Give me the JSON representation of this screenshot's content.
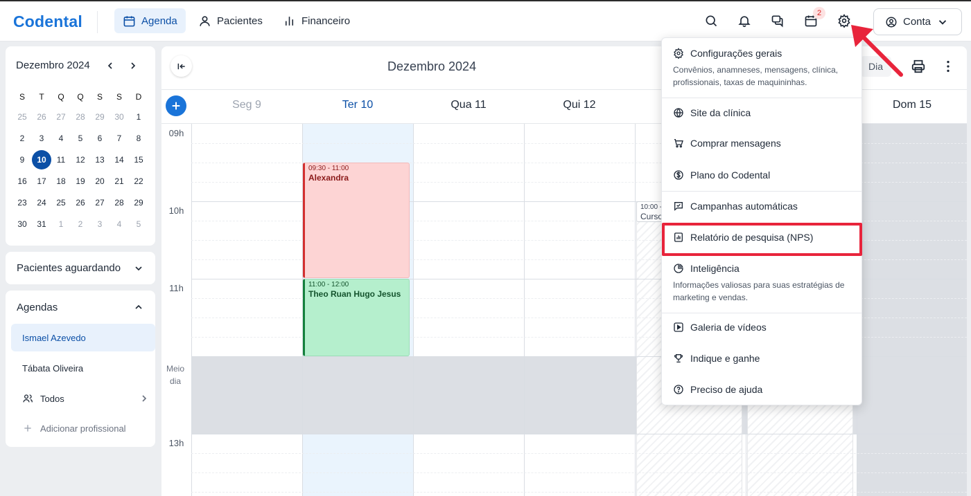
{
  "app": {
    "logo": "Codental",
    "nav": [
      {
        "label": "Agenda",
        "icon": "calendar-icon",
        "active": true
      },
      {
        "label": "Pacientes",
        "icon": "user-icon",
        "active": false
      },
      {
        "label": "Financeiro",
        "icon": "bar-chart-icon",
        "active": false
      }
    ],
    "top_icons": [
      "search-icon",
      "bell-icon",
      "chat-icon",
      "calendar-icon",
      "gear-icon"
    ],
    "notification_count": "2",
    "account_label": "Conta"
  },
  "sidebar": {
    "mini_calendar": {
      "title": "Dezembro 2024",
      "weekdays": [
        "S",
        "T",
        "Q",
        "Q",
        "S",
        "S",
        "D"
      ],
      "weeks": [
        [
          "25",
          "26",
          "27",
          "28",
          "29",
          "30",
          "1"
        ],
        [
          "2",
          "3",
          "4",
          "5",
          "6",
          "7",
          "8"
        ],
        [
          "9",
          "10",
          "11",
          "12",
          "13",
          "14",
          "15"
        ],
        [
          "16",
          "17",
          "18",
          "19",
          "20",
          "21",
          "22"
        ],
        [
          "23",
          "24",
          "25",
          "26",
          "27",
          "28",
          "29"
        ],
        [
          "30",
          "31",
          "1",
          "2",
          "3",
          "4",
          "5"
        ]
      ],
      "selected_day": "10"
    },
    "waiting_patients_label": "Pacientes aguardando",
    "agendas_title": "Agendas",
    "agendas": [
      "Ismael Azevedo",
      "Tábata Oliveira"
    ],
    "all_label": "Todos",
    "add_professional_label": "Adicionar profissional"
  },
  "calendar": {
    "title": "Dezembro 2024",
    "view_label": "Dia",
    "days": [
      {
        "label": "Seg 9"
      },
      {
        "label": "Ter 10"
      },
      {
        "label": "Qua 11"
      },
      {
        "label": "Qui 12"
      },
      {
        "label": ""
      },
      {
        "label": ""
      },
      {
        "label": "Dom 15"
      }
    ],
    "hours": [
      "09h",
      "10h",
      "11h",
      "Meio dia",
      "13h"
    ],
    "events": [
      {
        "time": "09:30 - 11:00",
        "name": "Alexandra",
        "color": "#fdd4d4"
      },
      {
        "time": "11:00 - 12:00",
        "name": "Theo Ruan Hugo Jesus",
        "color": "#b5efcd"
      },
      {
        "time": "10:00 -",
        "name": "Curso"
      }
    ]
  },
  "settings_menu": {
    "items": [
      {
        "label": "Configurações gerais",
        "icon": "gear-icon",
        "description": "Convênios, anamneses, mensagens, clínica, profissionais, taxas de maquininhas."
      },
      {
        "label": "Site da clínica",
        "icon": "globe-icon"
      },
      {
        "label": "Comprar mensagens",
        "icon": "cart-icon"
      },
      {
        "label": "Plano do Codental",
        "icon": "dollar-icon"
      },
      {
        "label": "Campanhas automáticas",
        "icon": "message-check-icon"
      },
      {
        "label": "Relatório de pesquisa (NPS)",
        "icon": "report-icon",
        "highlighted": true
      },
      {
        "label": "Inteligência",
        "icon": "pie-chart-icon",
        "description": "Informações valiosas para suas estratégias de marketing e vendas."
      },
      {
        "label": "Galeria de vídeos",
        "icon": "play-icon"
      },
      {
        "label": "Indique e ganhe",
        "icon": "trophy-icon"
      },
      {
        "label": "Preciso de ajuda",
        "icon": "help-icon"
      }
    ]
  },
  "colors": {
    "accent": "#1a74d9",
    "highlight": "#e8243b"
  }
}
